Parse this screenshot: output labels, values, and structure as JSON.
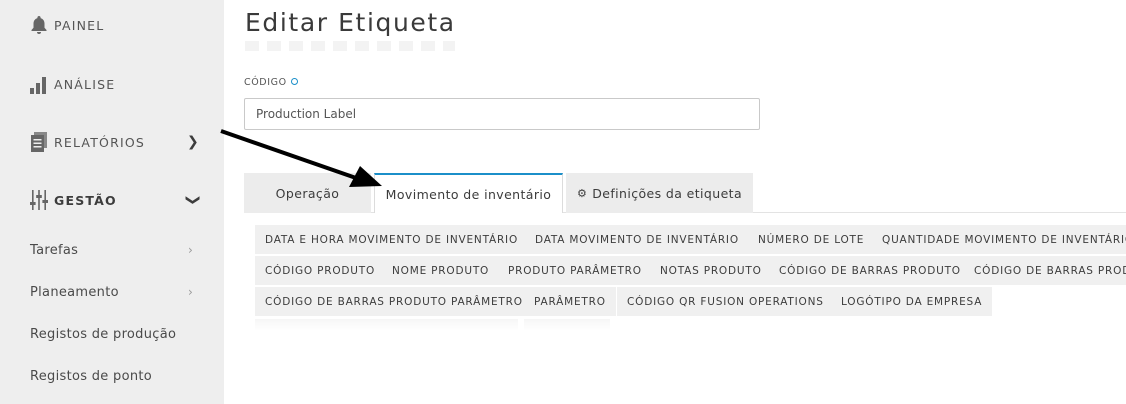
{
  "sidebar": {
    "items": [
      {
        "label": "PAINEL"
      },
      {
        "label": "ANÁLISE"
      },
      {
        "label": "RELATÓRIOS"
      },
      {
        "label": "GESTÃO"
      }
    ],
    "subitems": [
      {
        "label": "Tarefas"
      },
      {
        "label": "Planeamento"
      },
      {
        "label": "Registos de produção"
      },
      {
        "label": "Registos de ponto"
      }
    ]
  },
  "page": {
    "title": "Editar Etiqueta"
  },
  "form": {
    "code_label": "CÓDIGO",
    "code_value": "Production Label"
  },
  "tabs": [
    {
      "label": "Operação"
    },
    {
      "label": "Movimento de inventário"
    },
    {
      "label": "Definições da etiqueta"
    }
  ],
  "tokens": [
    "DATA E HORA MOVIMENTO DE INVENTÁRIO",
    "DATA MOVIMENTO DE INVENTÁRIO",
    "NÚMERO DE LOTE",
    "QUANTIDADE MOVIMENTO DE INVENTÁRIO",
    "CÓDIGO PRODUTO",
    "NOME PRODUTO",
    "PRODUTO PARÂMETRO",
    "NOTAS PRODUTO",
    "CÓDIGO DE BARRAS PRODUTO",
    "CÓDIGO DE BARRAS PRODUTO",
    "CÓDIGO DE BARRAS PRODUTO PARÂMETRO",
    "PARÂMETRO",
    "CÓDIGO QR FUSION OPERATIONS",
    "LOGÓTIPO DA EMPRESA"
  ],
  "colors": {
    "accent": "#1b8fc9",
    "sidebar_bg": "#eeeeee",
    "token_bg": "#f0f0f0"
  }
}
